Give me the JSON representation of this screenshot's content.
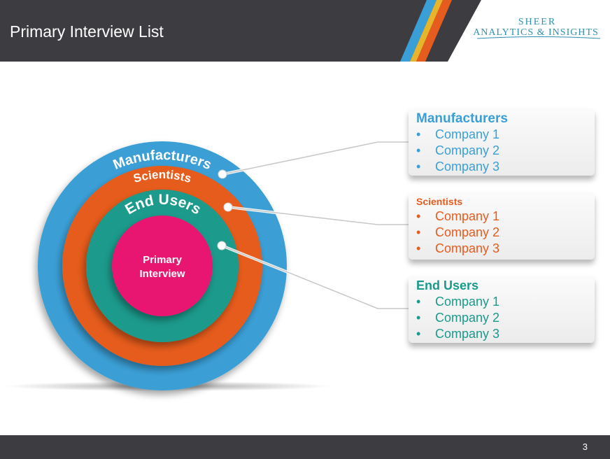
{
  "header": {
    "title": "Primary Interview List"
  },
  "logo": {
    "line1": "SHEER",
    "line2": "ANALYTICS & INSIGHTS"
  },
  "diagram": {
    "rings": {
      "outer": "Manufacturers",
      "middle": "Scientists",
      "inner": "End Users",
      "core_line1": "Primary",
      "core_line2": "Interview"
    }
  },
  "groups": [
    {
      "title": "Manufacturers",
      "items": [
        "Company 1",
        "Company 2",
        "Company 3"
      ],
      "color": "#3a9fd6"
    },
    {
      "title": "Scientists",
      "items": [
        "Company 1",
        "Company 2",
        "Company 3"
      ],
      "color": "#e65b1e"
    },
    {
      "title": "End Users",
      "items": [
        "Company 1",
        "Company 2",
        "Company 3"
      ],
      "color": "#1a9a8c"
    }
  ],
  "bullet": "•",
  "footer": {
    "page": "3"
  },
  "colors": {
    "header_bg": "#3d3c41",
    "blue": "#3a9fd6",
    "orange": "#e65b1e",
    "teal": "#1a9a8c",
    "pink": "#e8166f"
  }
}
